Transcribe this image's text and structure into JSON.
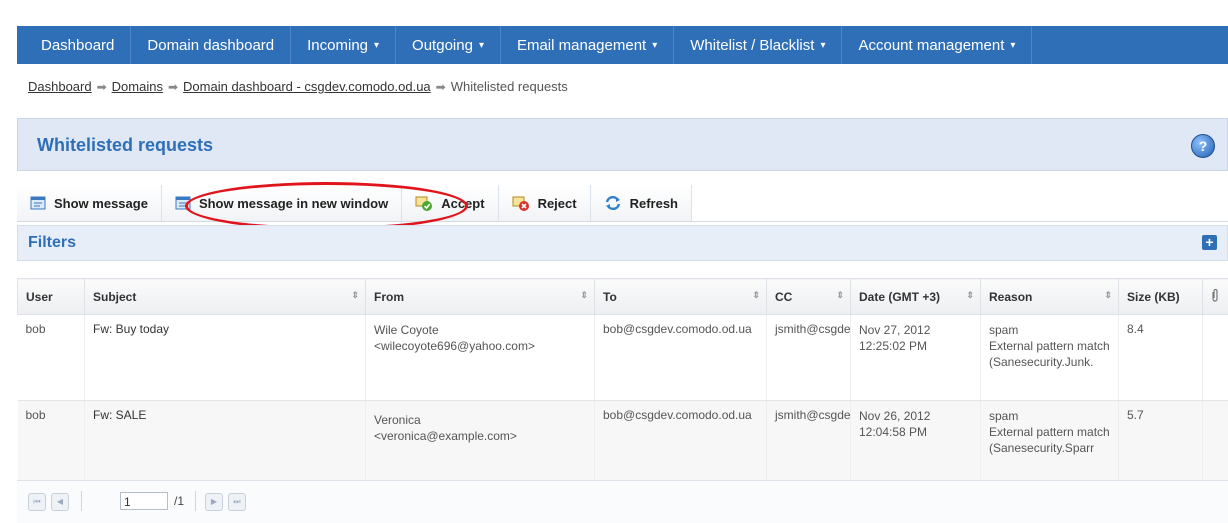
{
  "nav": [
    {
      "label": "Dashboard",
      "caret": ""
    },
    {
      "label": "Domain dashboard",
      "caret": ""
    },
    {
      "label": "Incoming",
      "caret": "▾"
    },
    {
      "label": "Outgoing",
      "caret": "▾"
    },
    {
      "label": "Email management",
      "caret": "▾"
    },
    {
      "label": "Whitelist / Blacklist",
      "caret": "▾"
    },
    {
      "label": "Account management",
      "caret": "▾"
    }
  ],
  "breadcrumb": {
    "items": [
      "Dashboard",
      "Domains",
      "Domain dashboard - csgdev.comodo.od.ua"
    ],
    "current": "Whitelisted requests"
  },
  "panel": {
    "title": "Whitelisted requests",
    "help_icon": "?"
  },
  "toolbar": {
    "show_message": "Show message",
    "show_message_new_window": "Show message in new window",
    "accept": "Accept",
    "reject": "Reject",
    "refresh": "Refresh"
  },
  "filters": {
    "title": "Filters",
    "expand_icon": "+"
  },
  "table": {
    "columns": [
      "User",
      "Subject",
      "From",
      "To",
      "CC",
      "Date (GMT +3)",
      "Reason",
      "Size (KB)"
    ],
    "rows": [
      {
        "user": "bob",
        "subject": "Fw: Buy today",
        "from_name": "Wile Coyote",
        "from_email": "<wilecoyote696@yahoo.com>",
        "to": "bob@csgdev.comodo.od.ua",
        "cc": "jsmith@csgdev.comodo.od.ua",
        "date": "Nov 27, 2012",
        "time": "12:25:02 PM",
        "reason_1": "spam",
        "reason_2": "External pattern match",
        "reason_3": "(Sanesecurity.Junk.",
        "size": "8.4"
      },
      {
        "user": "bob",
        "subject": "Fw: SALE",
        "from_name": "Veronica",
        "from_email": "<veronica@example.com>",
        "to": "bob@csgdev.comodo.od.ua",
        "cc": "jsmith@csgdev.comodo.od.ua",
        "date": "Nov 26, 2012",
        "time": "12:04:58 PM",
        "reason_1": "spam",
        "reason_2": "External pattern match",
        "reason_3": "(Sanesecurity.Sparr",
        "size": "5.7"
      }
    ]
  },
  "pager": {
    "page": "1",
    "total": "/1"
  }
}
